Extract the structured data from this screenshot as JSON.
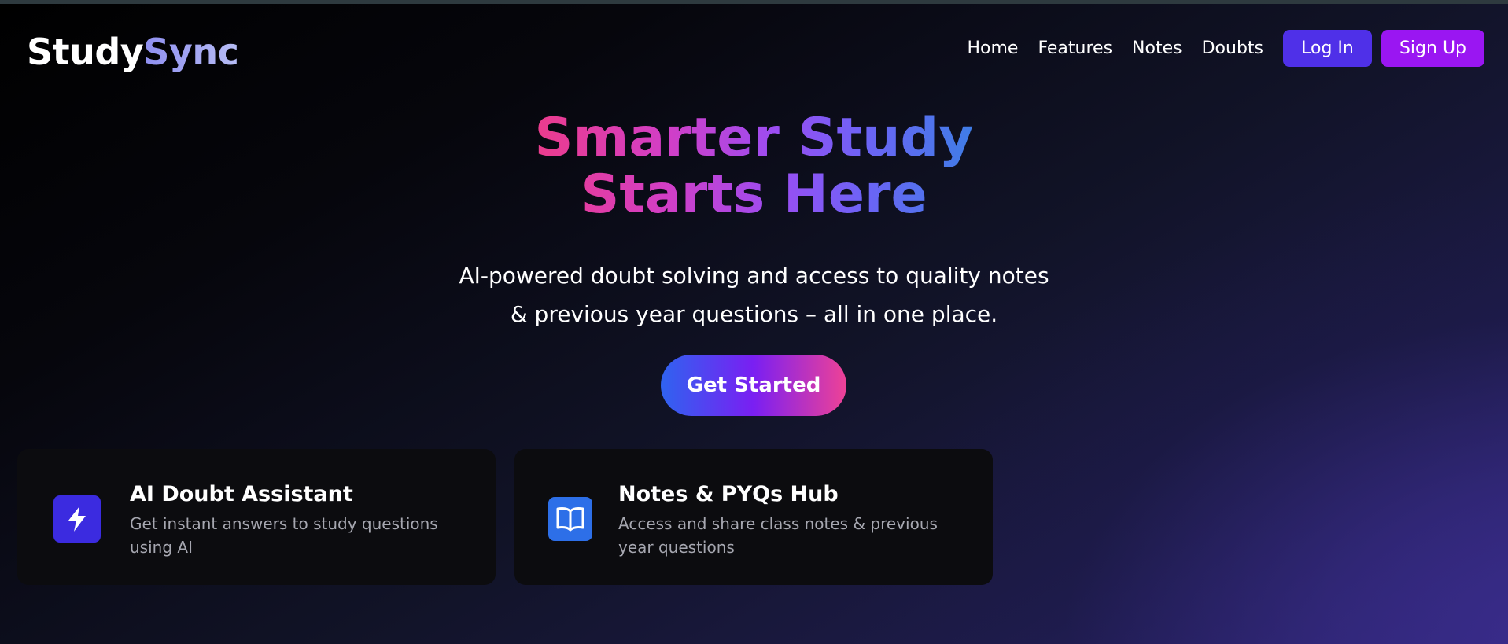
{
  "header": {
    "logo_part_a": "Study",
    "logo_part_b": "Sync",
    "nav": [
      {
        "label": "Home"
      },
      {
        "label": "Features"
      },
      {
        "label": "Notes"
      },
      {
        "label": "Doubts"
      }
    ],
    "login_label": "Log In",
    "signup_label": "Sign Up"
  },
  "hero": {
    "title_line_1": "Smarter Study",
    "title_line_2": "Starts Here",
    "subtitle_line_1": "AI-powered doubt solving and access to quality notes",
    "subtitle_line_2": "& previous year questions – all in one place.",
    "cta_label": "Get Started"
  },
  "features": [
    {
      "icon": "lightning-icon",
      "title": "AI Doubt Assistant",
      "description": "Get instant answers to study questions using AI"
    },
    {
      "icon": "book-icon",
      "title": "Notes & PYQs Hub",
      "description": "Access and share class notes & previous year questions"
    }
  ],
  "colors": {
    "login_button": "#4f30e8",
    "signup_button": "#9a16f2",
    "card_background": "#0c0c0f",
    "ai_icon_bg": "#3b2be0",
    "notes_icon_bg": "#2d6fe8"
  }
}
